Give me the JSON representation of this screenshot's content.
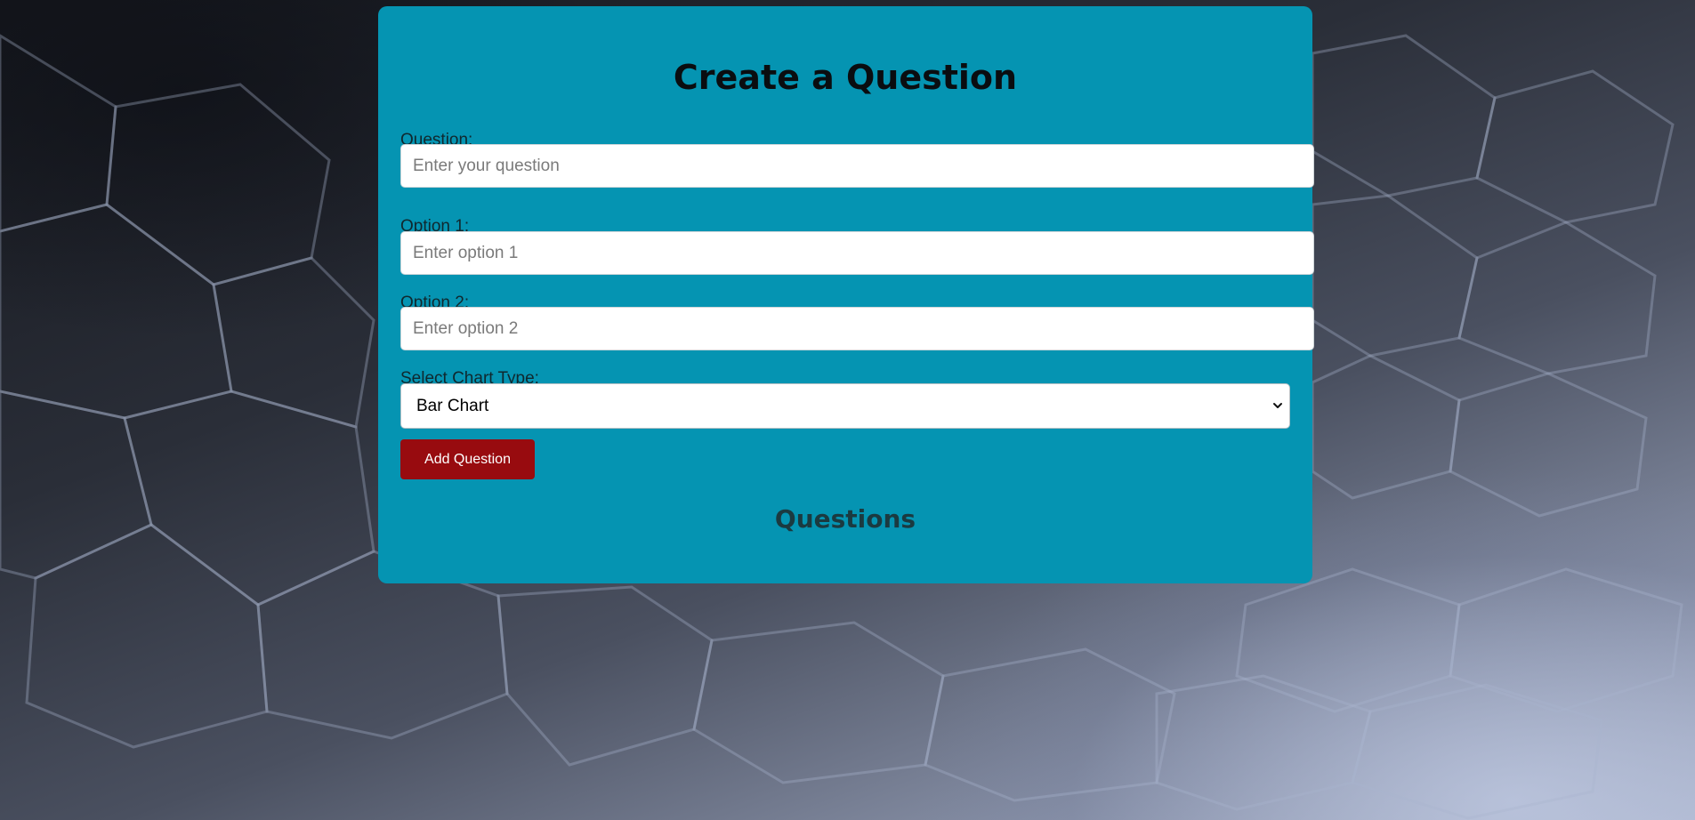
{
  "form": {
    "title": "Create a Question",
    "question": {
      "label": "Question:",
      "placeholder": "Enter your question",
      "value": ""
    },
    "option1": {
      "label": "Option 1:",
      "placeholder": "Enter option 1",
      "value": ""
    },
    "option2": {
      "label": "Option 2:",
      "placeholder": "Enter option 2",
      "value": ""
    },
    "chart_type": {
      "label": "Select Chart Type:",
      "selected": "Bar Chart"
    },
    "add_button_label": "Add Question"
  },
  "questions_section": {
    "heading": "Questions"
  },
  "colors": {
    "card_background": "#0594b2",
    "button_background": "#980b0f",
    "title_text": "#0a0d10"
  }
}
